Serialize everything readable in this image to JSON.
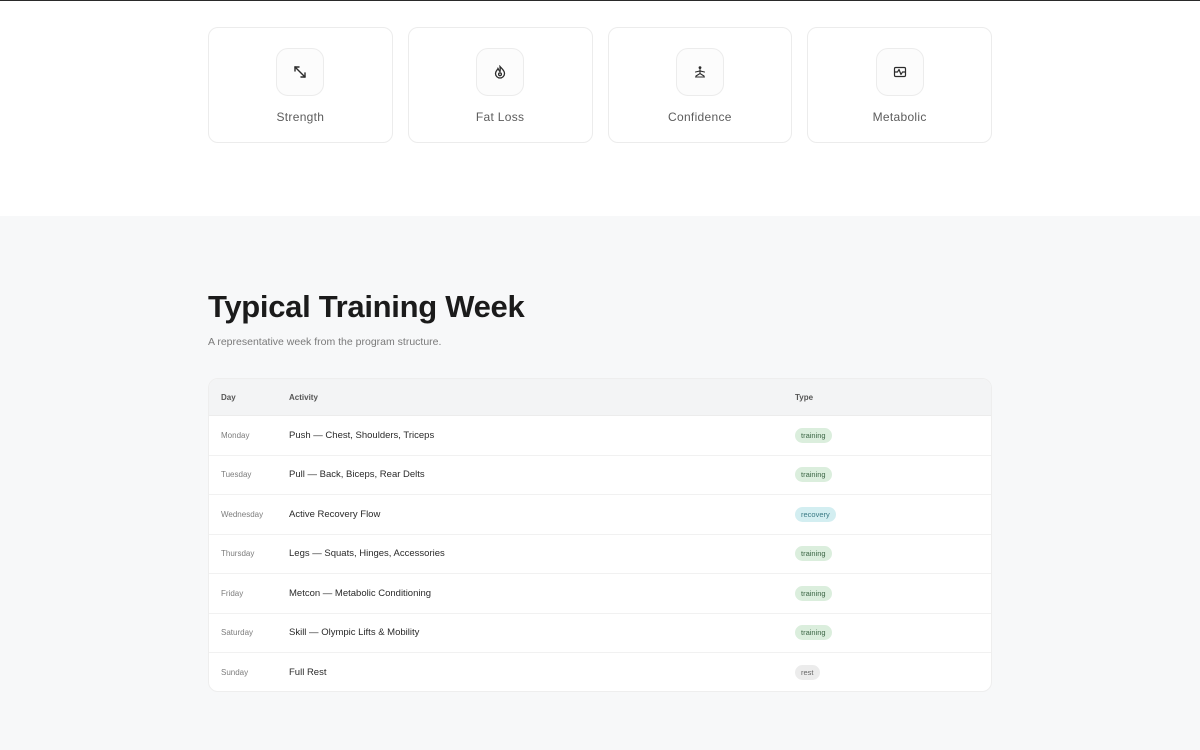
{
  "goals": [
    {
      "label": "Strength",
      "icon": "expand-arrows-icon"
    },
    {
      "label": "Fat Loss",
      "icon": "flame-icon"
    },
    {
      "label": "Confidence",
      "icon": "person-meditate-icon"
    },
    {
      "label": "Metabolic",
      "icon": "heart-monitor-icon"
    }
  ],
  "week": {
    "title": "Typical Training Week",
    "subtitle": "A representative week from the program structure.",
    "headers": {
      "day": "Day",
      "activity": "Activity",
      "type": "Type"
    },
    "rows": [
      {
        "day": "Monday",
        "activity": "Push — Chest, Shoulders, Triceps",
        "type": "training"
      },
      {
        "day": "Tuesday",
        "activity": "Pull — Back, Biceps, Rear Delts",
        "type": "training"
      },
      {
        "day": "Wednesday",
        "activity": "Active Recovery Flow",
        "type": "recovery"
      },
      {
        "day": "Thursday",
        "activity": "Legs — Squats, Hinges, Accessories",
        "type": "training"
      },
      {
        "day": "Friday",
        "activity": "Metcon — Metabolic Conditioning",
        "type": "training"
      },
      {
        "day": "Saturday",
        "activity": "Skill — Olympic Lifts & Mobility",
        "type": "training"
      },
      {
        "day": "Sunday",
        "activity": "Full Rest",
        "type": "rest"
      }
    ]
  },
  "colors": {
    "training_badge_bg": "#dbeedd",
    "recovery_badge_bg": "#d3eef1",
    "rest_badge_bg": "#ececec",
    "section_bg": "#f7f8f9"
  }
}
